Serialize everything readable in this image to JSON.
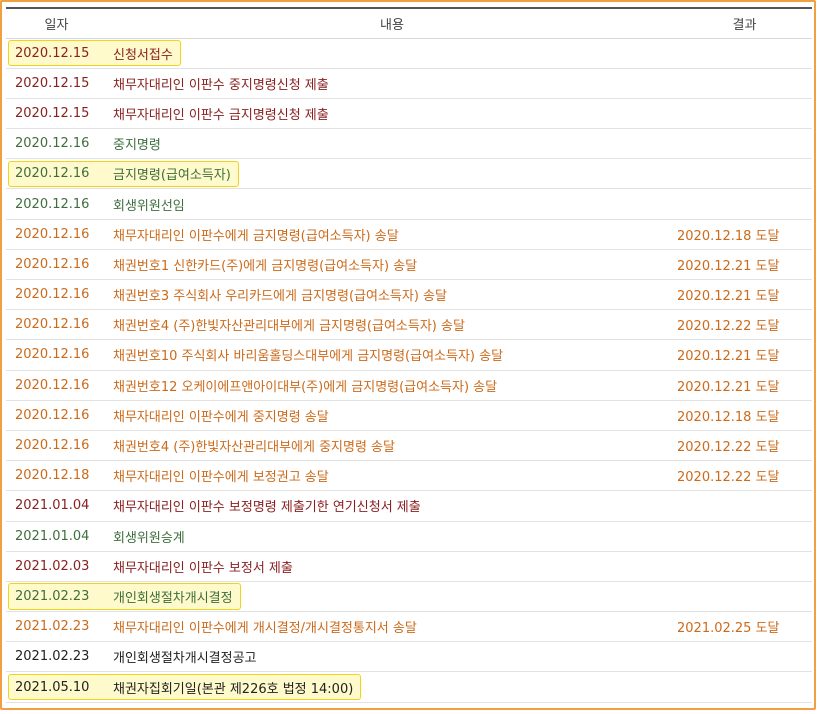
{
  "header": {
    "date": "일자",
    "content": "내용",
    "result": "결과"
  },
  "rows": [
    {
      "date": "2020.12.15",
      "content": "신청서접수",
      "result": "",
      "color": "red",
      "highlight": true
    },
    {
      "date": "2020.12.15",
      "content": "채무자대리인 이판수 중지명령신청 제출",
      "result": "",
      "color": "red",
      "highlight": false
    },
    {
      "date": "2020.12.15",
      "content": "채무자대리인 이판수 금지명령신청 제출",
      "result": "",
      "color": "red",
      "highlight": false
    },
    {
      "date": "2020.12.16",
      "content": "중지명령",
      "result": "",
      "color": "green",
      "highlight": false
    },
    {
      "date": "2020.12.16",
      "content": "금지명령(급여소득자)",
      "result": "",
      "color": "green",
      "highlight": true
    },
    {
      "date": "2020.12.16",
      "content": "회생위원선임",
      "result": "",
      "color": "green",
      "highlight": false
    },
    {
      "date": "2020.12.16",
      "content": "채무자대리인 이판수에게 금지명령(급여소득자) 송달",
      "result": "2020.12.18 도달",
      "color": "orange",
      "highlight": false
    },
    {
      "date": "2020.12.16",
      "content": "채권번호1 신한카드(주)에게 금지명령(급여소득자) 송달",
      "result": "2020.12.21 도달",
      "color": "orange",
      "highlight": false
    },
    {
      "date": "2020.12.16",
      "content": "채권번호3 주식회사 우리카드에게 금지명령(급여소득자) 송달",
      "result": "2020.12.21 도달",
      "color": "orange",
      "highlight": false
    },
    {
      "date": "2020.12.16",
      "content": "채권번호4 (주)한빛자산관리대부에게 금지명령(급여소득자) 송달",
      "result": "2020.12.22 도달",
      "color": "orange",
      "highlight": false
    },
    {
      "date": "2020.12.16",
      "content": "채권번호10 주식회사 바리움홀딩스대부에게 금지명령(급여소득자) 송달",
      "result": "2020.12.21 도달",
      "color": "orange",
      "highlight": false
    },
    {
      "date": "2020.12.16",
      "content": "채권번호12 오케이에프앤아이대부(주)에게 금지명령(급여소득자) 송달",
      "result": "2020.12.21 도달",
      "color": "orange",
      "highlight": false
    },
    {
      "date": "2020.12.16",
      "content": "채무자대리인 이판수에게 중지명령 송달",
      "result": "2020.12.18 도달",
      "color": "orange",
      "highlight": false
    },
    {
      "date": "2020.12.16",
      "content": "채권번호4 (주)한빛자산관리대부에게 중지명령 송달",
      "result": "2020.12.22 도달",
      "color": "orange",
      "highlight": false
    },
    {
      "date": "2020.12.18",
      "content": "채무자대리인 이판수에게 보정권고 송달",
      "result": "2020.12.22 도달",
      "color": "orange",
      "highlight": false
    },
    {
      "date": "2021.01.04",
      "content": "채무자대리인 이판수 보정명령 제출기한 연기신청서 제출",
      "result": "",
      "color": "red",
      "highlight": false
    },
    {
      "date": "2021.01.04",
      "content": "회생위원승계",
      "result": "",
      "color": "green",
      "highlight": false
    },
    {
      "date": "2021.02.03",
      "content": "채무자대리인 이판수 보정서 제출",
      "result": "",
      "color": "red",
      "highlight": false
    },
    {
      "date": "2021.02.23",
      "content": "개인회생절차개시결정",
      "result": "",
      "color": "green",
      "highlight": true
    },
    {
      "date": "2021.02.23",
      "content": "채무자대리인 이판수에게 개시결정/개시결정통지서 송달",
      "result": "2021.02.25 도달",
      "color": "orange",
      "highlight": false
    },
    {
      "date": "2021.02.23",
      "content": "개인회생절차개시결정공고",
      "result": "",
      "color": "black",
      "highlight": false
    },
    {
      "date": "2021.05.10",
      "content": "채권자집회기일(본관 제226호 법정 14:00)",
      "result": "",
      "color": "black",
      "highlight": true
    }
  ]
}
